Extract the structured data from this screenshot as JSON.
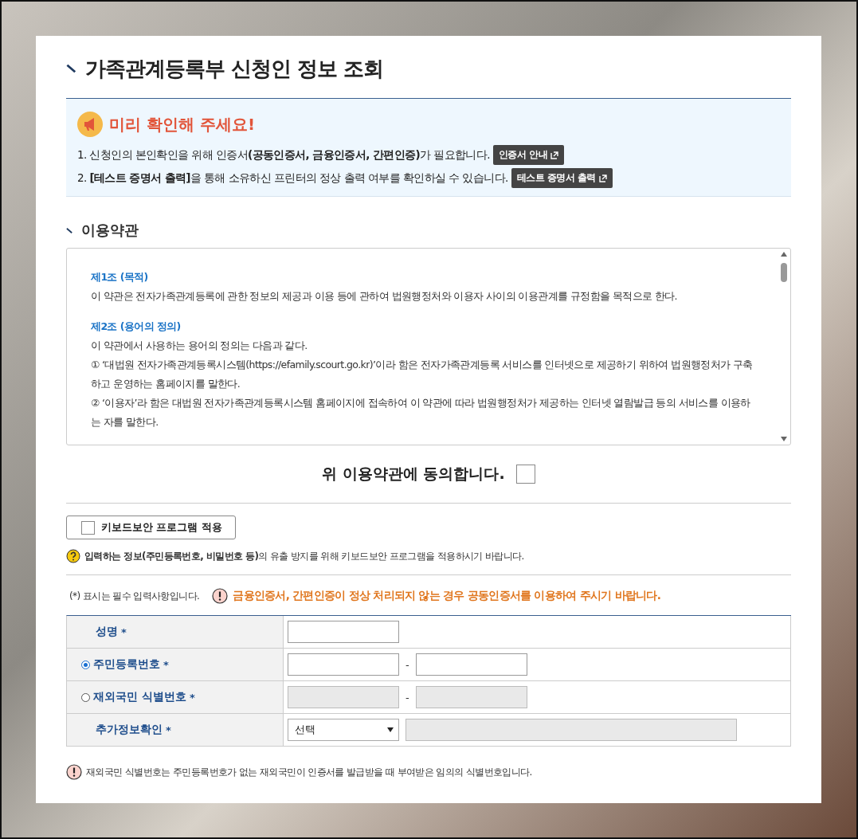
{
  "page_title": "가족관계등록부 신청인 정보 조회",
  "notice": {
    "title": "미리 확인해 주세요!",
    "lines": [
      {
        "text": "1. 신청인의 본인확인을 위해 인증서**(공동인증서, 금융인증서, 간편인증)**가 필요합니다.",
        "button": "인증서 안내"
      },
      {
        "text": "2. **[테스트 증명서 출력]**을 통해 소유하신 프린터의 정상 출력 여부를 확인하실 수 있습니다.",
        "button": "테스트 증명서 출력"
      }
    ]
  },
  "terms": {
    "title": "이용약관",
    "paragraphs": [
      {
        "kind": "heading",
        "text": "제1조 (목적)"
      },
      {
        "kind": "body",
        "text": "이 약관은 전자가족관계등록에 관한 정보의 제공과 이용 등에 관하여 법원행정처와 이용자 사이의 이용관계를 규정함을 목적으로 한다."
      },
      {
        "kind": "heading",
        "text": "제2조 (용어의 정의)"
      },
      {
        "kind": "body",
        "text": "이 약관에서 사용하는 용어의 정의는 다음과 같다."
      },
      {
        "kind": "body",
        "text": "① ‘대법원 전자가족관계등록시스템(https://efamily.scourt.go.kr)’이라 함은 전자가족관계등록 서비스를 인터넷으로 제공하기 위하여 법원행정처가 구축하고 운영하는 홈페이지를 말한다."
      },
      {
        "kind": "body",
        "text": "② ‘이용자’라 함은 대법원 전자가족관계등록시스템 홈페이지에 접속하여 이 약관에 따라 법원행정처가 제공하는 인터넷 열람발급 등의 서비스를 이용하는 자를 말한다."
      }
    ],
    "agree_label": "위 이용약관에 동의합니다.",
    "agree_checked": false
  },
  "keyboard_security": {
    "label": "키보드보안 프로그램 적용",
    "checked": false,
    "help": "**입력하는 정보(주민등록번호, 비밀번호 등)**의 유출 방지를 위해 키보드보안 프로그램을 적용하시기 바랍니다."
  },
  "required_note": "(*) 표시는 필수 입력사항입니다.",
  "warning": "금융인증서, 간편인증이 정상 처리되지 않는 경우 공동인증서를 이용하여 주시기 바랍니다.",
  "form_rows": [
    {
      "kind": "text",
      "label": "성명",
      "mark": "*",
      "disabled": false
    },
    {
      "kind": "radio_pair",
      "label": "주민등록번호",
      "mark": "*",
      "selected": true,
      "separator": "-",
      "disabled": false
    },
    {
      "kind": "radio_pair",
      "label": "재외국민 식별번호",
      "mark": "*",
      "selected": false,
      "separator": "-",
      "disabled": true
    },
    {
      "kind": "select",
      "label": "추가정보확인",
      "mark": "*",
      "value": "선택",
      "disabled": true
    }
  ],
  "footnote": "재외국민 식별번호는 주민등록번호가 없는 재외국민이 인증서를 발급받을 때 부여받은 임의의 식별번호입니다."
}
